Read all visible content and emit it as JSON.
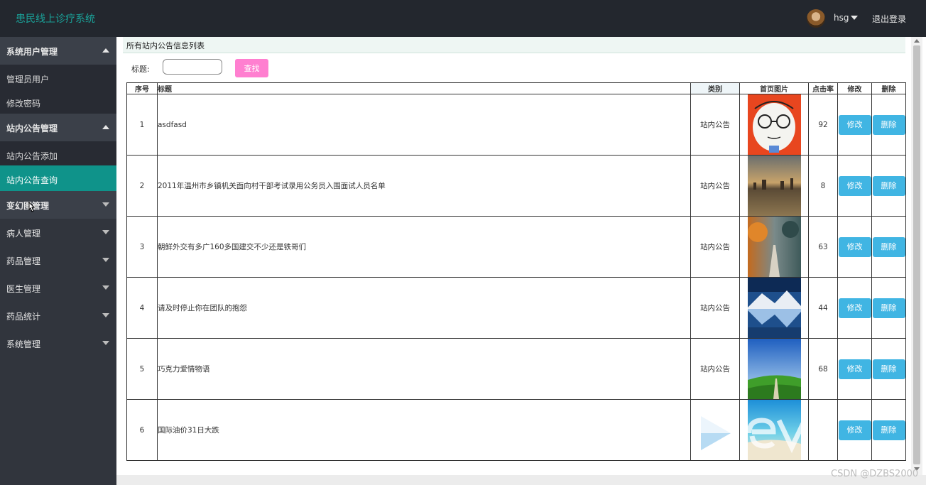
{
  "app": {
    "title": "患民线上诊疗系统"
  },
  "user": {
    "name": "hsg",
    "logout_label": "退出登录"
  },
  "sidebar": {
    "items": [
      {
        "label": "系统用户管理",
        "type": "group",
        "expanded": true
      },
      {
        "label": "管理员用户",
        "type": "sub"
      },
      {
        "label": "修改密码",
        "type": "sub"
      },
      {
        "label": "站内公告管理",
        "type": "group",
        "expanded": true
      },
      {
        "label": "站内公告添加",
        "type": "sub"
      },
      {
        "label": "站内公告查询",
        "type": "sub",
        "active": true
      },
      {
        "label": "变幻图管理",
        "type": "group",
        "expanded": false
      },
      {
        "label": "病人管理",
        "type": "group",
        "expanded": false
      },
      {
        "label": "药品管理",
        "type": "group",
        "expanded": false
      },
      {
        "label": "医生管理",
        "type": "group",
        "expanded": false
      },
      {
        "label": "药品统计",
        "type": "group",
        "expanded": false
      },
      {
        "label": "系统管理",
        "type": "group",
        "expanded": false
      }
    ]
  },
  "main": {
    "panel_title": "所有站内公告信息列表",
    "search": {
      "label": "标题:",
      "value": "",
      "button_label": "查找"
    },
    "table": {
      "headers": [
        "序号",
        "标题",
        "类别",
        "首页图片",
        "点击率",
        "修改",
        "删除"
      ],
      "edit_label": "修改",
      "delete_label": "删除",
      "rows": [
        {
          "no": "1",
          "title": "asdfasd",
          "category": "站内公告",
          "image": "cartoon-face-thumbnail",
          "clicks": "92"
        },
        {
          "no": "2",
          "title": "2011年温州市乡镇机关面向村干部考试录用公务员入围面试人员名单",
          "category": "站内公告",
          "image": "lake-town-thumbnail",
          "clicks": "8"
        },
        {
          "no": "3",
          "title": "朝鲜外交有多广160多国建交不少还是铁哥们",
          "category": "站内公告",
          "image": "autumn-path-thumbnail",
          "clicks": "63"
        },
        {
          "no": "4",
          "title": "请及时停止你在团队的抱怨",
          "category": "站内公告",
          "image": "mountain-reflection-thumbnail",
          "clicks": "44"
        },
        {
          "no": "5",
          "title": "巧克力爱情物语",
          "category": "站内公告",
          "image": "green-field-thumbnail",
          "clicks": "68"
        },
        {
          "no": "6",
          "title": "国际油价31日大跌",
          "category": "",
          "image": "beach-thumbnail",
          "clicks": ""
        }
      ]
    }
  },
  "watermark": "CSDN @DZBS2000",
  "colors": {
    "topbar": "#23272e",
    "sidebar": "#31353d",
    "active_nav": "#0f938a",
    "search_button": "#ff7fd0",
    "action_button": "#40b5e3"
  }
}
